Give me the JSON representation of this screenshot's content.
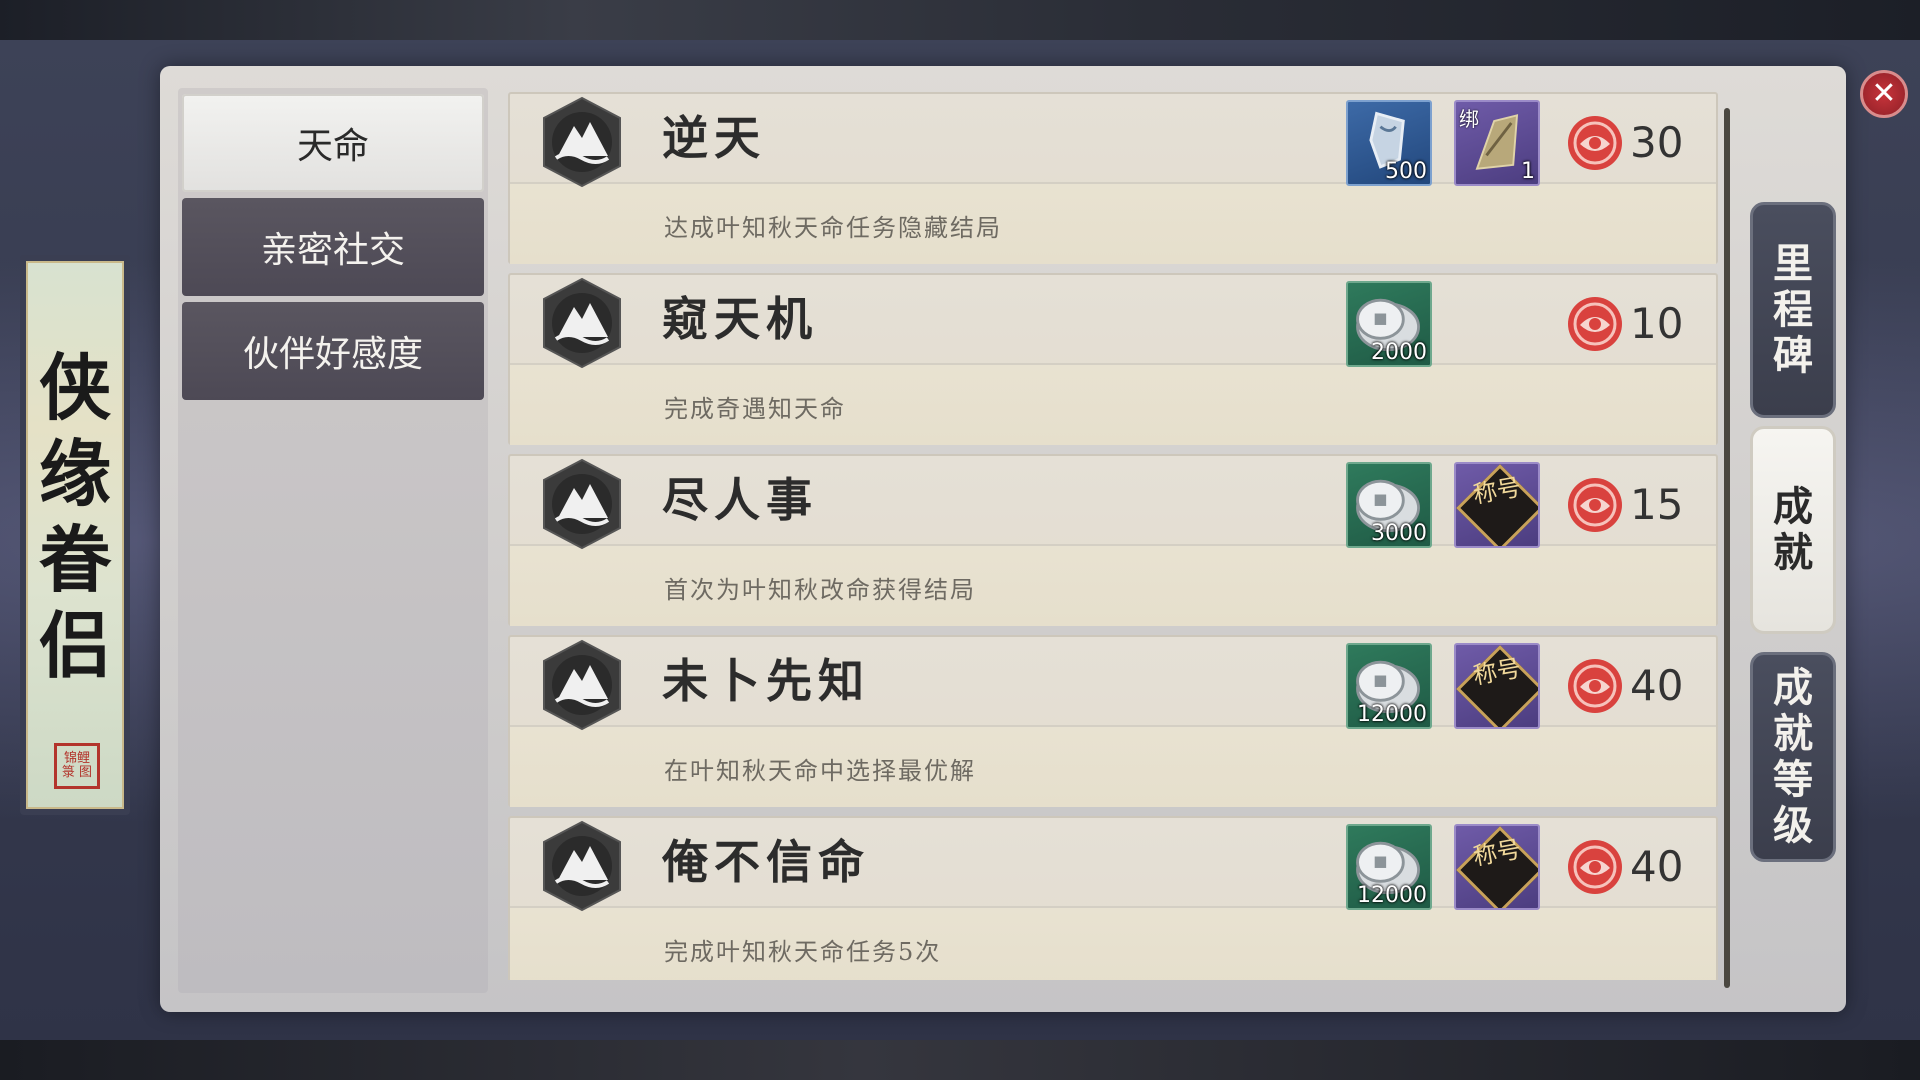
{
  "scroll": {
    "title": "侠缘眷侣",
    "seal": "锦鲤 箓 图"
  },
  "tabs": [
    {
      "label": "天命",
      "active": true
    },
    {
      "label": "亲密社交",
      "active": false
    },
    {
      "label": "伙伴好感度",
      "active": false
    }
  ],
  "achievements": [
    {
      "title": "逆天",
      "desc": "达成叶知秋天命任务隐藏结局",
      "rewards": [
        {
          "icon": "jade-token-icon",
          "qty": "500",
          "color": "blue"
        },
        {
          "icon": "bound-book-icon",
          "qty": "1",
          "bind": "绑",
          "color": "purple"
        }
      ],
      "points": "30"
    },
    {
      "title": "窥天机",
      "desc": "完成奇遇知天命",
      "rewards": [
        {
          "icon": "silver-coin-icon",
          "qty": "2000",
          "color": "green"
        }
      ],
      "points": "10"
    },
    {
      "title": "尽人事",
      "desc": "首次为叶知秋改命获得结局",
      "rewards": [
        {
          "icon": "silver-coin-icon",
          "qty": "3000",
          "color": "green"
        },
        {
          "icon": "title-badge-icon",
          "label": "称号",
          "color": "purple"
        }
      ],
      "points": "15"
    },
    {
      "title": "未卜先知",
      "desc": "在叶知秋天命中选择最优解",
      "rewards": [
        {
          "icon": "silver-coin-icon",
          "qty": "12000",
          "color": "green"
        },
        {
          "icon": "title-badge-icon",
          "label": "称号",
          "color": "purple"
        }
      ],
      "points": "40"
    },
    {
      "title": "俺不信命",
      "desc": "完成叶知秋天命任务5次",
      "rewards": [
        {
          "icon": "silver-coin-icon",
          "qty": "12000",
          "color": "green"
        },
        {
          "icon": "title-badge-icon",
          "label": "称号",
          "color": "purple"
        }
      ],
      "points": "40"
    }
  ],
  "right_tabs": [
    {
      "label": "里程碑",
      "active": false
    },
    {
      "label": "成就",
      "active": true
    },
    {
      "label": "成就等级",
      "active": false
    }
  ],
  "close": "✕",
  "colors": {
    "accent_red": "#c8343b",
    "panel": "#dedbd7",
    "tab_dark": "#4d4955"
  }
}
